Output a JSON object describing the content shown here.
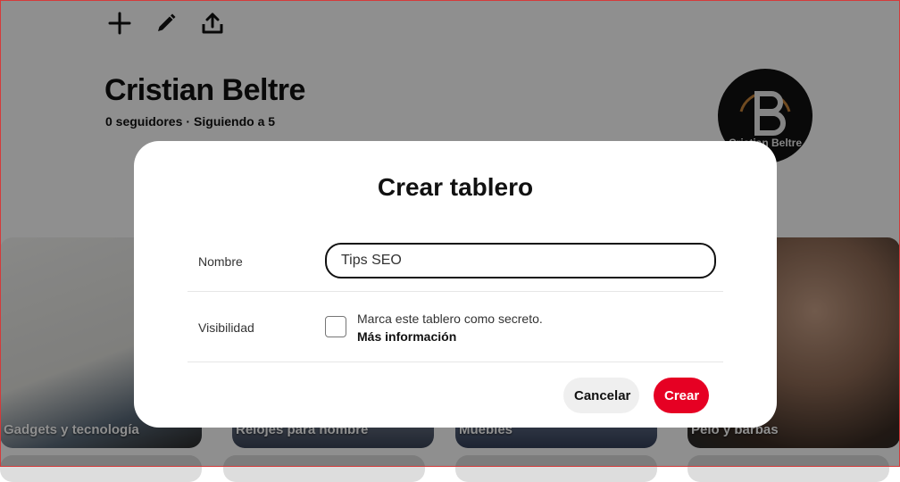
{
  "toolbar": {
    "icons": [
      "plus-icon",
      "pencil-icon",
      "share-upload-icon"
    ]
  },
  "profile": {
    "name": "Cristian Beltre",
    "followers": "0 seguidores",
    "separator": "·",
    "following": "Siguiendo a 5",
    "avatar_text": "Cristian Beltre"
  },
  "boards": [
    {
      "title": "Gadgets y tecnología"
    },
    {
      "title": "Relojes para hombre"
    },
    {
      "title": "Muebles"
    },
    {
      "title": "Pelo y barbas"
    }
  ],
  "modal": {
    "title": "Crear tablero",
    "name_label": "Nombre",
    "name_value": "Tips SEO",
    "visibility_label": "Visibilidad",
    "secret_text": "Marca este tablero como secreto.",
    "more_info": "Más información",
    "cancel_label": "Cancelar",
    "create_label": "Crear"
  },
  "colors": {
    "accent": "#e60023",
    "overlay": "rgba(0,0,0,0.44)"
  }
}
